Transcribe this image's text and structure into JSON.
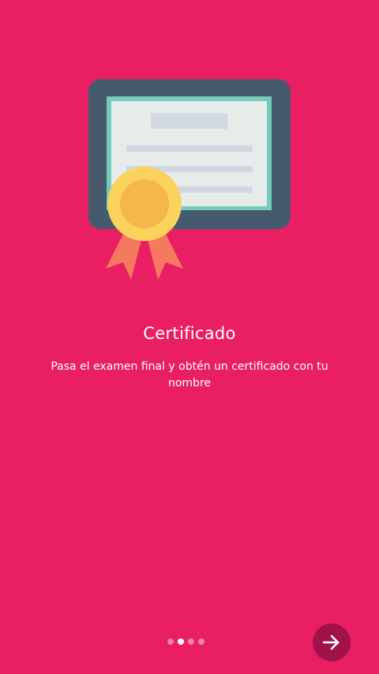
{
  "onboarding": {
    "title": "Certificado",
    "description": "Pasa el examen final y obtén un certificado con tu nombre",
    "illustration_icon": "certificate-icon",
    "next_icon": "arrow-right-icon",
    "pager": {
      "total_pages": 4,
      "active_page": 2
    }
  },
  "colors": {
    "background": "#E91E63",
    "next_button": "#A0134A",
    "frame": "#465A6E",
    "paper": "#E7ECEA",
    "paper_border": "#74CBB8",
    "medal": "#FBD35C",
    "ribbon": "#F4795E"
  }
}
